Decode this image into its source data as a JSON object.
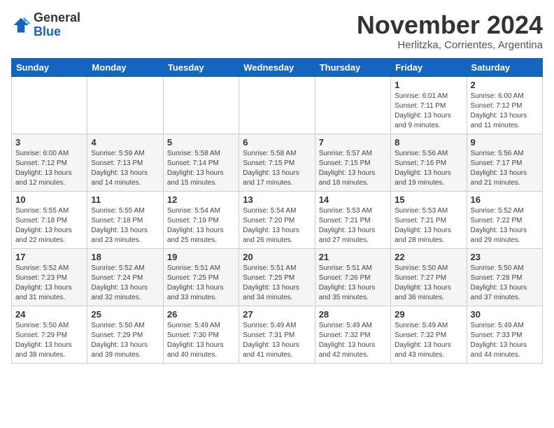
{
  "header": {
    "logo_general": "General",
    "logo_blue": "Blue",
    "month_title": "November 2024",
    "subtitle": "Herlitzka, Corrientes, Argentina"
  },
  "weekdays": [
    "Sunday",
    "Monday",
    "Tuesday",
    "Wednesday",
    "Thursday",
    "Friday",
    "Saturday"
  ],
  "weeks": [
    [
      {
        "day": "",
        "info": ""
      },
      {
        "day": "",
        "info": ""
      },
      {
        "day": "",
        "info": ""
      },
      {
        "day": "",
        "info": ""
      },
      {
        "day": "",
        "info": ""
      },
      {
        "day": "1",
        "info": "Sunrise: 6:01 AM\nSunset: 7:11 PM\nDaylight: 13 hours\nand 9 minutes."
      },
      {
        "day": "2",
        "info": "Sunrise: 6:00 AM\nSunset: 7:12 PM\nDaylight: 13 hours\nand 11 minutes."
      }
    ],
    [
      {
        "day": "3",
        "info": "Sunrise: 6:00 AM\nSunset: 7:12 PM\nDaylight: 13 hours\nand 12 minutes."
      },
      {
        "day": "4",
        "info": "Sunrise: 5:59 AM\nSunset: 7:13 PM\nDaylight: 13 hours\nand 14 minutes."
      },
      {
        "day": "5",
        "info": "Sunrise: 5:58 AM\nSunset: 7:14 PM\nDaylight: 13 hours\nand 15 minutes."
      },
      {
        "day": "6",
        "info": "Sunrise: 5:58 AM\nSunset: 7:15 PM\nDaylight: 13 hours\nand 17 minutes."
      },
      {
        "day": "7",
        "info": "Sunrise: 5:57 AM\nSunset: 7:15 PM\nDaylight: 13 hours\nand 18 minutes."
      },
      {
        "day": "8",
        "info": "Sunrise: 5:56 AM\nSunset: 7:16 PM\nDaylight: 13 hours\nand 19 minutes."
      },
      {
        "day": "9",
        "info": "Sunrise: 5:56 AM\nSunset: 7:17 PM\nDaylight: 13 hours\nand 21 minutes."
      }
    ],
    [
      {
        "day": "10",
        "info": "Sunrise: 5:55 AM\nSunset: 7:18 PM\nDaylight: 13 hours\nand 22 minutes."
      },
      {
        "day": "11",
        "info": "Sunrise: 5:55 AM\nSunset: 7:18 PM\nDaylight: 13 hours\nand 23 minutes."
      },
      {
        "day": "12",
        "info": "Sunrise: 5:54 AM\nSunset: 7:19 PM\nDaylight: 13 hours\nand 25 minutes."
      },
      {
        "day": "13",
        "info": "Sunrise: 5:54 AM\nSunset: 7:20 PM\nDaylight: 13 hours\nand 26 minutes."
      },
      {
        "day": "14",
        "info": "Sunrise: 5:53 AM\nSunset: 7:21 PM\nDaylight: 13 hours\nand 27 minutes."
      },
      {
        "day": "15",
        "info": "Sunrise: 5:53 AM\nSunset: 7:21 PM\nDaylight: 13 hours\nand 28 minutes."
      },
      {
        "day": "16",
        "info": "Sunrise: 5:52 AM\nSunset: 7:22 PM\nDaylight: 13 hours\nand 29 minutes."
      }
    ],
    [
      {
        "day": "17",
        "info": "Sunrise: 5:52 AM\nSunset: 7:23 PM\nDaylight: 13 hours\nand 31 minutes."
      },
      {
        "day": "18",
        "info": "Sunrise: 5:52 AM\nSunset: 7:24 PM\nDaylight: 13 hours\nand 32 minutes."
      },
      {
        "day": "19",
        "info": "Sunrise: 5:51 AM\nSunset: 7:25 PM\nDaylight: 13 hours\nand 33 minutes."
      },
      {
        "day": "20",
        "info": "Sunrise: 5:51 AM\nSunset: 7:25 PM\nDaylight: 13 hours\nand 34 minutes."
      },
      {
        "day": "21",
        "info": "Sunrise: 5:51 AM\nSunset: 7:26 PM\nDaylight: 13 hours\nand 35 minutes."
      },
      {
        "day": "22",
        "info": "Sunrise: 5:50 AM\nSunset: 7:27 PM\nDaylight: 13 hours\nand 36 minutes."
      },
      {
        "day": "23",
        "info": "Sunrise: 5:50 AM\nSunset: 7:28 PM\nDaylight: 13 hours\nand 37 minutes."
      }
    ],
    [
      {
        "day": "24",
        "info": "Sunrise: 5:50 AM\nSunset: 7:29 PM\nDaylight: 13 hours\nand 38 minutes."
      },
      {
        "day": "25",
        "info": "Sunrise: 5:50 AM\nSunset: 7:29 PM\nDaylight: 13 hours\nand 39 minutes."
      },
      {
        "day": "26",
        "info": "Sunrise: 5:49 AM\nSunset: 7:30 PM\nDaylight: 13 hours\nand 40 minutes."
      },
      {
        "day": "27",
        "info": "Sunrise: 5:49 AM\nSunset: 7:31 PM\nDaylight: 13 hours\nand 41 minutes."
      },
      {
        "day": "28",
        "info": "Sunrise: 5:49 AM\nSunset: 7:32 PM\nDaylight: 13 hours\nand 42 minutes."
      },
      {
        "day": "29",
        "info": "Sunrise: 5:49 AM\nSunset: 7:32 PM\nDaylight: 13 hours\nand 43 minutes."
      },
      {
        "day": "30",
        "info": "Sunrise: 5:49 AM\nSunset: 7:33 PM\nDaylight: 13 hours\nand 44 minutes."
      }
    ]
  ]
}
